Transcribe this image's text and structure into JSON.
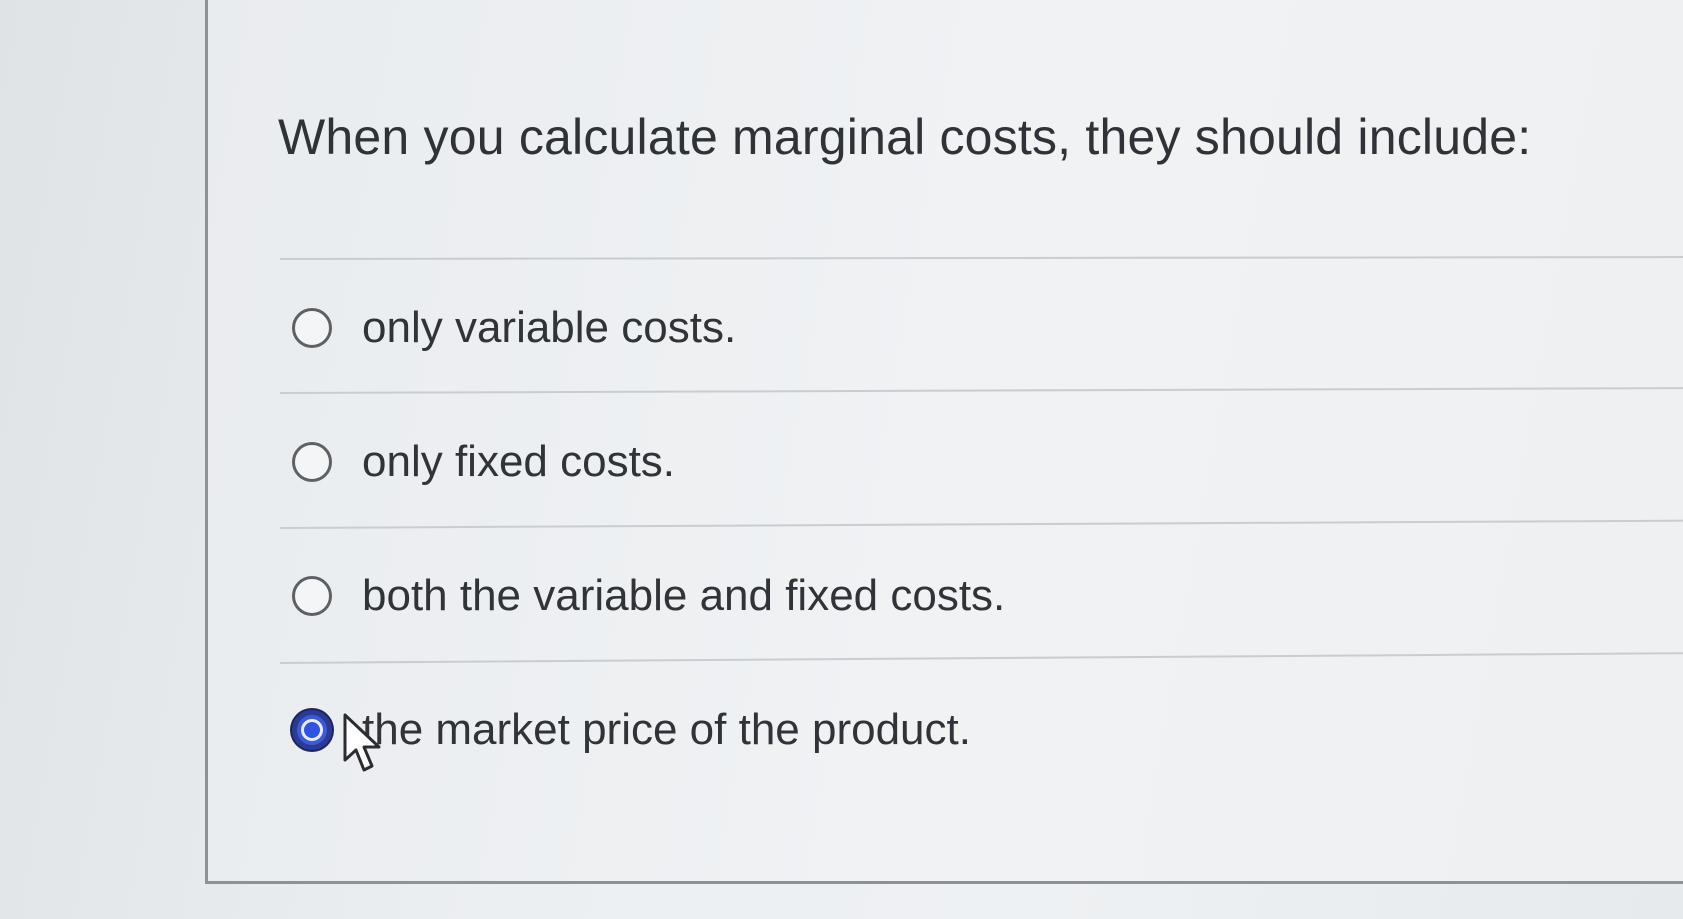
{
  "question": {
    "text": "When you calculate marginal costs, they should include:"
  },
  "options": [
    {
      "label": "only variable costs.",
      "selected": false
    },
    {
      "label": "only fixed costs.",
      "selected": false
    },
    {
      "label": "both the variable and fixed costs.",
      "selected": false
    },
    {
      "label": "the market price of the product.",
      "selected": true
    }
  ],
  "colors": {
    "selected_radio": "#3a5bd8",
    "text": "#303337",
    "divider": "#c9cdd1"
  },
  "icons": {
    "cursor": "mouse-pointer-icon"
  }
}
